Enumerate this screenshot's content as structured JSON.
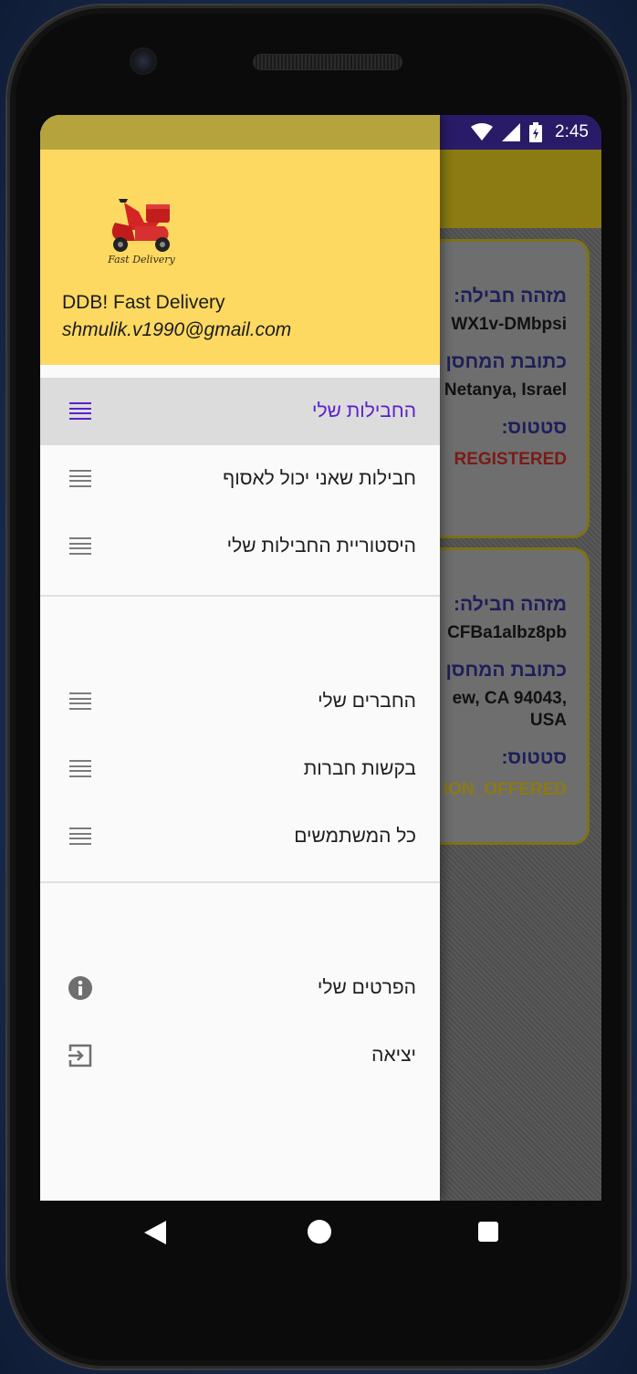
{
  "status_bar": {
    "time": "2:45"
  },
  "background_cards": [
    {
      "id_label": "מזהה חבילה:",
      "id_value": "WX1v-DMbpsi",
      "address_label": "כתובת המחסן",
      "address_value": "Netanya, Israel",
      "status_label": "סטטוס:",
      "status_value": "REGISTERED"
    },
    {
      "id_label": "מזהה חבילה:",
      "id_value": "CFBa1albz8pb",
      "address_label": "כתובת המחסן",
      "address_value_line1": "ew, CA 94043,",
      "address_value_line2": "USA",
      "status_label": "סטטוס:",
      "status_value": "ION_OFFERED"
    }
  ],
  "drawer": {
    "header": {
      "app_name": "DDB! Fast Delivery",
      "email": "shmulik.v1990@gmail.com",
      "logo_text": "Fast Delivery"
    },
    "section1": [
      {
        "label": "החבילות שלי",
        "icon": "list-icon",
        "active": true
      },
      {
        "label": "חבילות שאני יכול לאסוף",
        "icon": "list-icon",
        "active": false
      },
      {
        "label": "היסטוריית החבילות שלי",
        "icon": "list-icon",
        "active": false
      }
    ],
    "section2": [
      {
        "label": "החברים שלי",
        "icon": "list-icon"
      },
      {
        "label": "בקשות חברות",
        "icon": "list-icon"
      },
      {
        "label": "כל המשתמשים",
        "icon": "list-icon"
      }
    ],
    "section3": [
      {
        "label": "הפרטים שלי",
        "icon": "info-icon"
      },
      {
        "label": "יציאה",
        "icon": "logout-icon"
      }
    ]
  },
  "colors": {
    "header_yellow": "#fdd962",
    "accent_purple": "#5a21c8",
    "status_bar": "#2a1b68",
    "app_bar": "#8b7b12"
  }
}
